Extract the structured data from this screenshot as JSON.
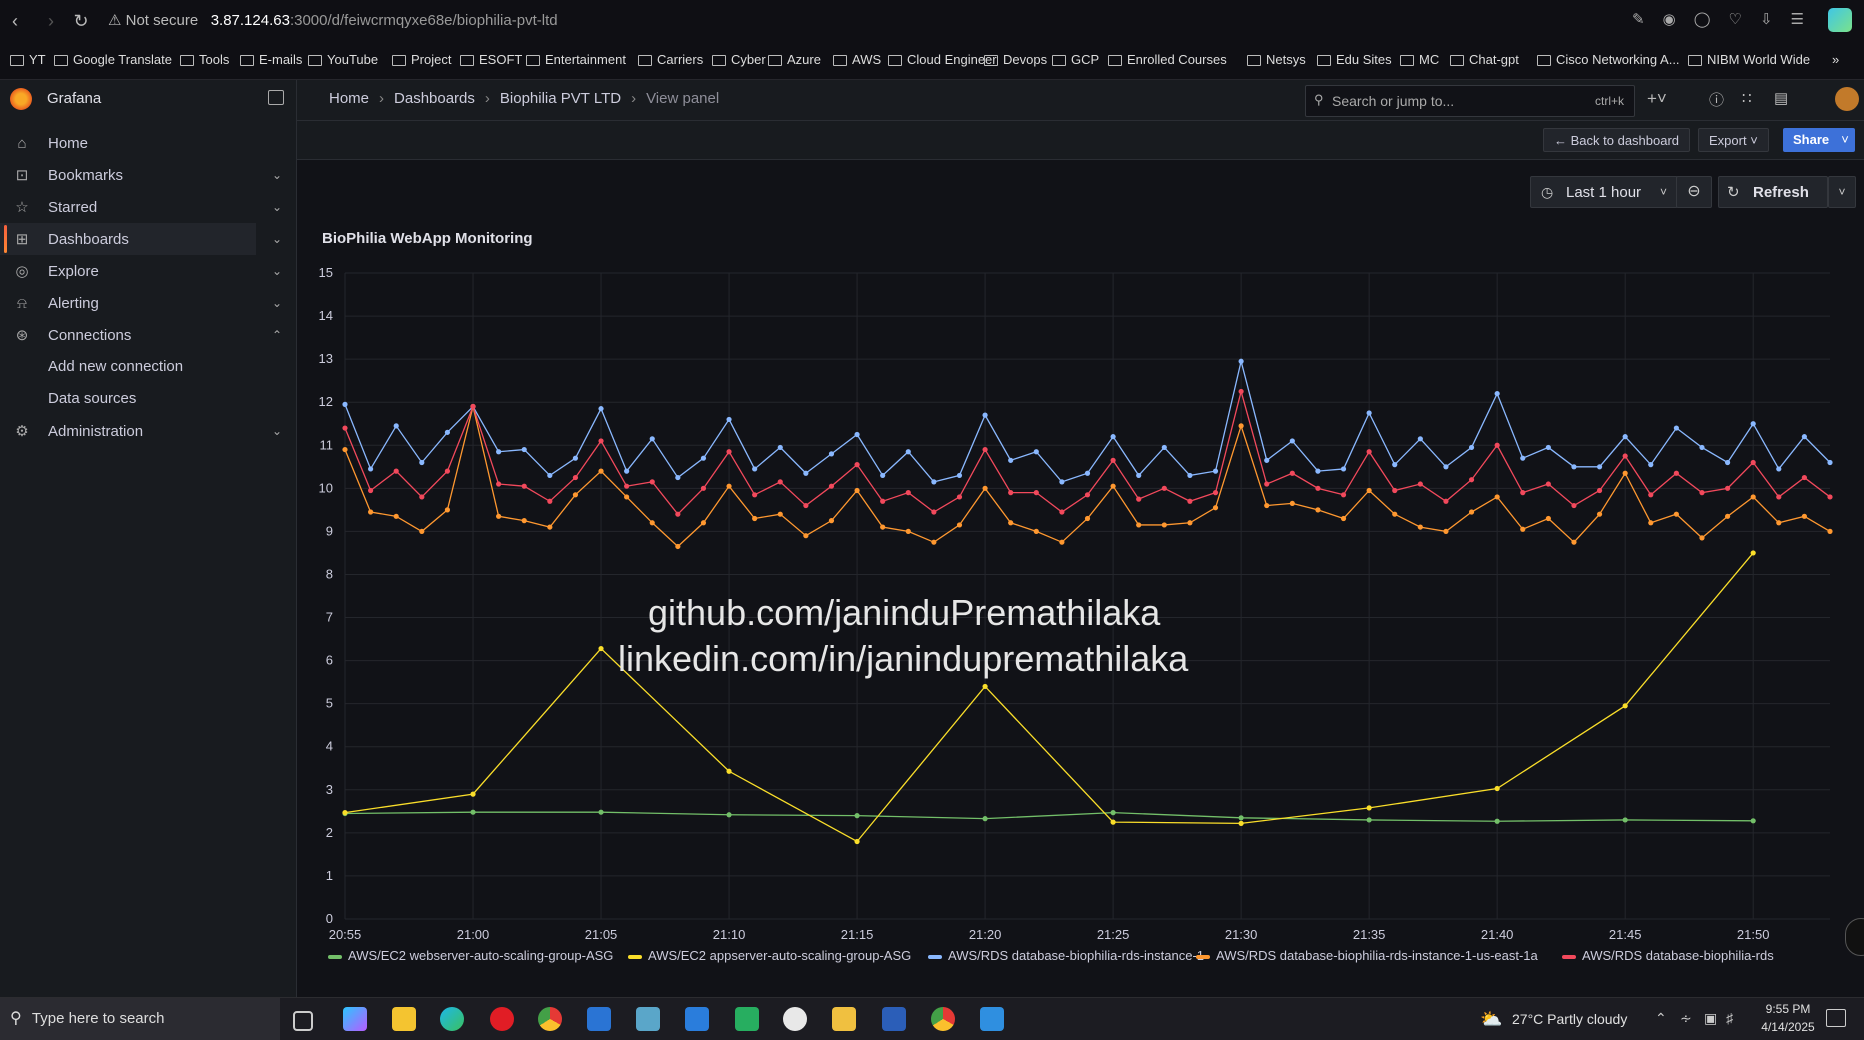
{
  "browser": {
    "security": "Not secure",
    "url_host": "3.87.124.63",
    "url_path": ":3000/d/feiwcrmqyxe68e/biophilia-pvt-ltd",
    "bookmarks": [
      "YT",
      "Google Translate",
      "Tools",
      "E-mails",
      "YouTube",
      "Project",
      "ESOFT",
      "Entertainment",
      "Carriers",
      "Cyber",
      "Azure",
      "AWS",
      "Cloud Engineer",
      "Devops",
      "GCP",
      "Enrolled Courses",
      "Netsys",
      "Edu Sites",
      "MC",
      "Chat-gpt",
      "Cisco Networking A...",
      "NIBM World Wide"
    ]
  },
  "app": {
    "name": "Grafana"
  },
  "sidebar": {
    "items": [
      {
        "label": "Home",
        "icon": "home-icon"
      },
      {
        "label": "Bookmarks",
        "icon": "bookmark-icon"
      },
      {
        "label": "Starred",
        "icon": "star-icon"
      },
      {
        "label": "Dashboards",
        "icon": "dashboards-icon"
      },
      {
        "label": "Explore",
        "icon": "compass-icon"
      },
      {
        "label": "Alerting",
        "icon": "bell-icon"
      },
      {
        "label": "Connections",
        "icon": "connections-icon"
      },
      {
        "label": "Administration",
        "icon": "gear-icon"
      }
    ],
    "sub_items": [
      "Add new connection",
      "Data sources"
    ]
  },
  "breadcrumb": [
    "Home",
    "Dashboards",
    "Biophilia PVT LTD",
    "View panel"
  ],
  "search": {
    "placeholder": "Search or jump to...",
    "shortcut": "ctrl+k"
  },
  "toolbar": {
    "back": "Back to dashboard",
    "export": "Export",
    "share": "Share"
  },
  "time": {
    "range": "Last 1 hour",
    "refresh": "Refresh"
  },
  "panel": {
    "title": "BioPhilia WebApp Monitoring"
  },
  "watermark": [
    "github.com/janinduPremathilaka",
    "linkedin.com/in/janindupremathilaka"
  ],
  "chart_data": {
    "type": "line",
    "ylim": [
      0,
      15
    ],
    "yticks": [
      "0",
      "1",
      "2",
      "3",
      "4",
      "5",
      "6",
      "7",
      "8",
      "9",
      "10",
      "11",
      "12",
      "13",
      "14",
      "15"
    ],
    "xticks": [
      "20:55",
      "21:00",
      "21:05",
      "21:10",
      "21:15",
      "21:20",
      "21:25",
      "21:30",
      "21:35",
      "21:40",
      "21:45",
      "21:50"
    ],
    "series": [
      {
        "name": "AWS/EC2 webserver-auto-scaling-group-ASG",
        "color": "#73bf69",
        "x": [
          0,
          5,
          10,
          15,
          20,
          25,
          30,
          35,
          40,
          45,
          50,
          55
        ],
        "y": [
          2.45,
          2.48,
          2.48,
          2.42,
          2.4,
          2.33,
          2.47,
          2.35,
          2.3,
          2.27,
          2.3,
          2.28
        ]
      },
      {
        "name": "AWS/EC2 appserver-auto-scaling-group-ASG",
        "color": "#fade2a",
        "x": [
          0,
          5,
          10,
          15,
          20,
          25,
          30,
          35,
          40,
          45,
          50,
          55
        ],
        "y": [
          2.47,
          2.9,
          6.28,
          3.43,
          1.8,
          5.4,
          2.25,
          2.22,
          2.58,
          3.03,
          4.95,
          8.5
        ]
      },
      {
        "name": "AWS/RDS database-biophilia-rds-instance-1",
        "color": "#8ab8ff",
        "x": [
          0,
          1,
          2,
          3,
          4,
          5,
          6,
          7,
          8,
          9,
          10,
          11,
          12,
          13,
          14,
          15,
          16,
          17,
          18,
          19,
          20,
          21,
          22,
          23,
          24,
          25,
          26,
          27,
          28,
          29,
          30,
          31,
          32,
          33,
          34,
          35,
          36,
          37,
          38,
          39,
          40,
          41,
          42,
          43,
          44,
          45,
          46,
          47,
          48,
          49,
          50,
          51,
          52,
          53,
          54,
          55,
          56,
          57,
          58
        ],
        "y": [
          11.95,
          10.45,
          11.45,
          10.6,
          11.3,
          11.9,
          10.85,
          10.9,
          10.3,
          10.7,
          11.85,
          10.4,
          11.15,
          10.25,
          10.7,
          11.6,
          10.45,
          10.95,
          10.35,
          10.8,
          11.25,
          10.3,
          10.85,
          10.15,
          10.3,
          11.7,
          10.65,
          10.85,
          10.15,
          10.35,
          11.2,
          10.3,
          10.95,
          10.3,
          10.4,
          12.95,
          10.65,
          11.1,
          10.4,
          10.45,
          11.75,
          10.55,
          11.15,
          10.5,
          10.95,
          12.2,
          10.7,
          10.95,
          10.5,
          10.5,
          11.2,
          10.55,
          11.4,
          10.95,
          10.6,
          11.5,
          10.45,
          11.2,
          10.6
        ]
      },
      {
        "name": "AWS/RDS database-biophilia-rds-instance-1-us-east-1a",
        "color": "#ff9830",
        "x": [
          0,
          1,
          2,
          3,
          4,
          5,
          6,
          7,
          8,
          9,
          10,
          11,
          12,
          13,
          14,
          15,
          16,
          17,
          18,
          19,
          20,
          21,
          22,
          23,
          24,
          25,
          26,
          27,
          28,
          29,
          30,
          31,
          32,
          33,
          34,
          35,
          36,
          37,
          38,
          39,
          40,
          41,
          42,
          43,
          44,
          45,
          46,
          47,
          48,
          49,
          50,
          51,
          52,
          53,
          54,
          55,
          56,
          57,
          58
        ],
        "y": [
          10.9,
          9.45,
          9.35,
          9.0,
          9.5,
          11.9,
          9.35,
          9.25,
          9.1,
          9.85,
          10.4,
          9.8,
          9.2,
          8.65,
          9.2,
          10.05,
          9.3,
          9.4,
          8.9,
          9.25,
          9.95,
          9.1,
          9.0,
          8.75,
          9.15,
          10.0,
          9.2,
          9.0,
          8.75,
          9.3,
          10.05,
          9.15,
          9.15,
          9.2,
          9.55,
          11.45,
          9.6,
          9.65,
          9.5,
          9.3,
          9.95,
          9.4,
          9.1,
          9.0,
          9.45,
          9.8,
          9.05,
          9.3,
          8.75,
          9.4,
          10.35,
          9.2,
          9.4,
          8.85,
          9.35,
          9.8,
          9.2,
          9.35,
          9.0
        ]
      },
      {
        "name": "AWS/RDS database-biophilia-rds",
        "color": "#f2495c",
        "x": [
          0,
          1,
          2,
          3,
          4,
          5,
          6,
          7,
          8,
          9,
          10,
          11,
          12,
          13,
          14,
          15,
          16,
          17,
          18,
          19,
          20,
          21,
          22,
          23,
          24,
          25,
          26,
          27,
          28,
          29,
          30,
          31,
          32,
          33,
          34,
          35,
          36,
          37,
          38,
          39,
          40,
          41,
          42,
          43,
          44,
          45,
          46,
          47,
          48,
          49,
          50,
          51,
          52,
          53,
          54,
          55,
          56,
          57,
          58
        ],
        "y": [
          11.4,
          9.95,
          10.4,
          9.8,
          10.4,
          11.9,
          10.1,
          10.05,
          9.7,
          10.25,
          11.1,
          10.05,
          10.15,
          9.4,
          10.0,
          10.85,
          9.85,
          10.15,
          9.6,
          10.05,
          10.55,
          9.7,
          9.9,
          9.45,
          9.8,
          10.9,
          9.9,
          9.9,
          9.45,
          9.85,
          10.65,
          9.75,
          10.0,
          9.7,
          9.9,
          12.25,
          10.1,
          10.35,
          10.0,
          9.85,
          10.85,
          9.95,
          10.1,
          9.7,
          10.2,
          11.0,
          9.9,
          10.1,
          9.6,
          9.95,
          10.75,
          9.85,
          10.35,
          9.9,
          10.0,
          10.6,
          9.8,
          10.25,
          9.8
        ]
      }
    ]
  },
  "taskbar": {
    "search_placeholder": "Type here to search",
    "weather": "27°C  Partly cloudy",
    "time": "9:55 PM",
    "date": "4/14/2025"
  }
}
